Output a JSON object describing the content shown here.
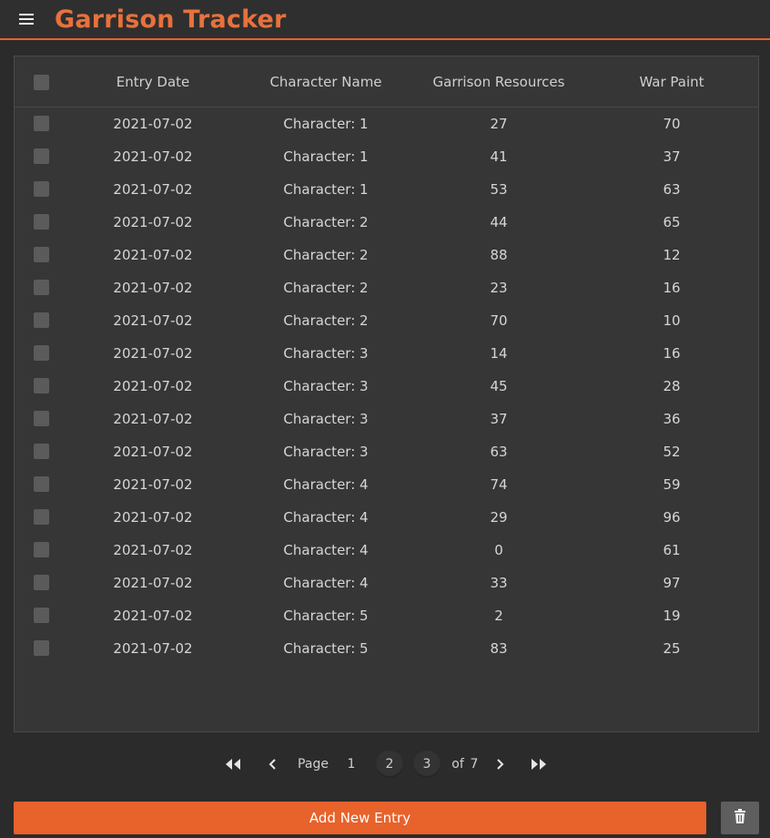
{
  "app": {
    "title": "Garrison Tracker"
  },
  "colors": {
    "accent": "#e8622b",
    "title": "#e8713c",
    "background": "#2b2b2b",
    "card": "#363636"
  },
  "table": {
    "headers": {
      "date": "Entry Date",
      "name": "Character Name",
      "resources": "Garrison Resources",
      "warpaint": "War Paint"
    },
    "rows": [
      {
        "date": "2021-07-02",
        "name": "Character: 1",
        "resources": "27",
        "warpaint": "70"
      },
      {
        "date": "2021-07-02",
        "name": "Character: 1",
        "resources": "41",
        "warpaint": "37"
      },
      {
        "date": "2021-07-02",
        "name": "Character: 1",
        "resources": "53",
        "warpaint": "63"
      },
      {
        "date": "2021-07-02",
        "name": "Character: 2",
        "resources": "44",
        "warpaint": "65"
      },
      {
        "date": "2021-07-02",
        "name": "Character: 2",
        "resources": "88",
        "warpaint": "12"
      },
      {
        "date": "2021-07-02",
        "name": "Character: 2",
        "resources": "23",
        "warpaint": "16"
      },
      {
        "date": "2021-07-02",
        "name": "Character: 2",
        "resources": "70",
        "warpaint": "10"
      },
      {
        "date": "2021-07-02",
        "name": "Character: 3",
        "resources": "14",
        "warpaint": "16"
      },
      {
        "date": "2021-07-02",
        "name": "Character: 3",
        "resources": "45",
        "warpaint": "28"
      },
      {
        "date": "2021-07-02",
        "name": "Character: 3",
        "resources": "37",
        "warpaint": "36"
      },
      {
        "date": "2021-07-02",
        "name": "Character: 3",
        "resources": "63",
        "warpaint": "52"
      },
      {
        "date": "2021-07-02",
        "name": "Character: 4",
        "resources": "74",
        "warpaint": "59"
      },
      {
        "date": "2021-07-02",
        "name": "Character: 4",
        "resources": "29",
        "warpaint": "96"
      },
      {
        "date": "2021-07-02",
        "name": "Character: 4",
        "resources": "0",
        "warpaint": "61"
      },
      {
        "date": "2021-07-02",
        "name": "Character: 4",
        "resources": "33",
        "warpaint": "97"
      },
      {
        "date": "2021-07-02",
        "name": "Character: 5",
        "resources": "2",
        "warpaint": "19"
      },
      {
        "date": "2021-07-02",
        "name": "Character: 5",
        "resources": "83",
        "warpaint": "25"
      }
    ]
  },
  "pagination": {
    "page_label": "Page",
    "pages": [
      "1",
      "2",
      "3"
    ],
    "of_label": "of",
    "total": "7",
    "icons": {
      "first": "double-chevron-left-icon",
      "prev": "chevron-left-icon",
      "next": "chevron-right-icon",
      "last": "double-chevron-right-icon"
    }
  },
  "actions": {
    "add_label": "Add New Entry",
    "delete_icon": "trash-icon",
    "menu_icon": "hamburger-menu-icon"
  }
}
